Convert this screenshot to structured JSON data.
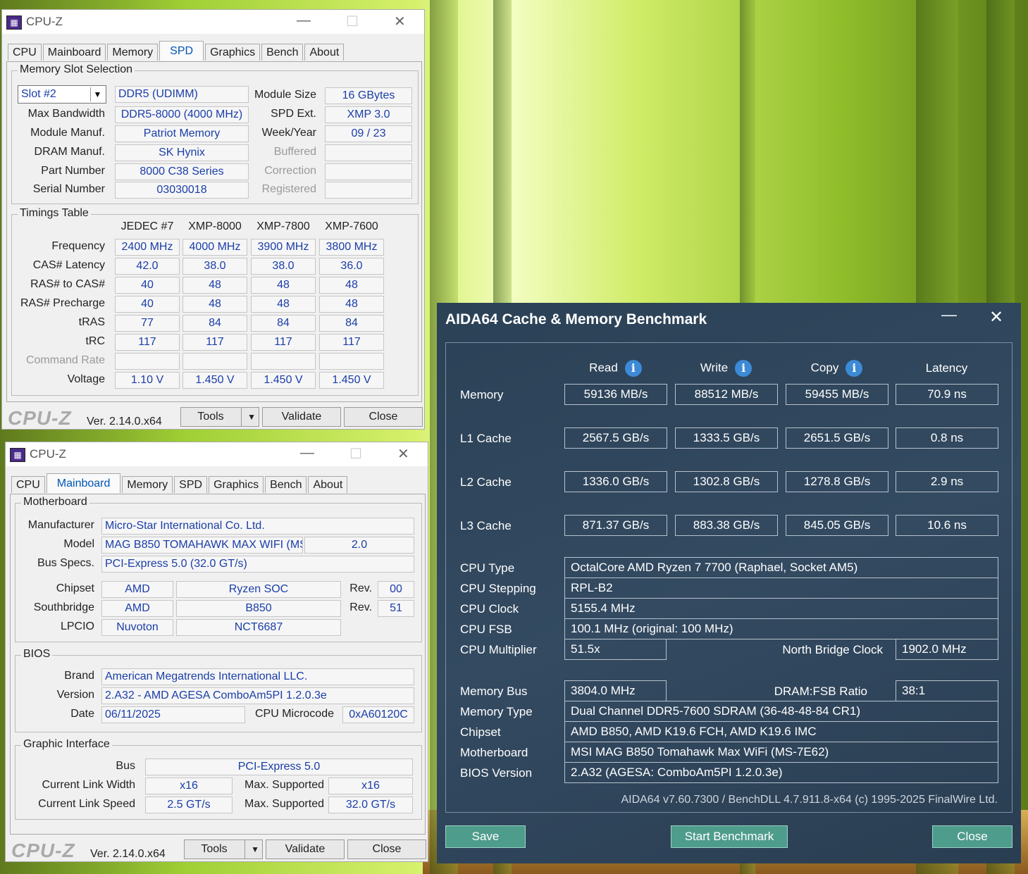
{
  "cpuz1": {
    "title": "CPU-Z",
    "tabs": [
      "CPU",
      "Mainboard",
      "Memory",
      "SPD",
      "Graphics",
      "Bench",
      "About"
    ],
    "slot_group": "Memory Slot Selection",
    "slot": "Slot #2",
    "type": "DDR5 (UDIMM)",
    "rows": [
      {
        "label": "Max Bandwidth",
        "value": "DDR5-8000 (4000 MHz)"
      },
      {
        "label": "Module Manuf.",
        "value": "Patriot Memory"
      },
      {
        "label": "DRAM Manuf.",
        "value": "SK Hynix"
      },
      {
        "label": "Part Number",
        "value": "8000 C38 Series"
      },
      {
        "label": "Serial Number",
        "value": "03030018"
      }
    ],
    "right_rows": [
      {
        "label": "Module Size",
        "value": "16 GBytes"
      },
      {
        "label": "SPD Ext.",
        "value": "XMP 3.0"
      },
      {
        "label": "Week/Year",
        "value": "09 / 23"
      },
      {
        "label": "Buffered",
        "value": ""
      },
      {
        "label": "Correction",
        "value": ""
      },
      {
        "label": "Registered",
        "value": ""
      }
    ],
    "timings_group": "Timings Table",
    "timing_cols": [
      "JEDEC #7",
      "XMP-8000",
      "XMP-7800",
      "XMP-7600"
    ],
    "timings": [
      {
        "label": "Frequency",
        "values": [
          "2400 MHz",
          "4000 MHz",
          "3900 MHz",
          "3800 MHz"
        ]
      },
      {
        "label": "CAS# Latency",
        "values": [
          "42.0",
          "38.0",
          "38.0",
          "36.0"
        ]
      },
      {
        "label": "RAS# to CAS#",
        "values": [
          "40",
          "48",
          "48",
          "48"
        ]
      },
      {
        "label": "RAS# Precharge",
        "values": [
          "40",
          "48",
          "48",
          "48"
        ]
      },
      {
        "label": "tRAS",
        "values": [
          "77",
          "84",
          "84",
          "84"
        ]
      },
      {
        "label": "tRC",
        "values": [
          "117",
          "117",
          "117",
          "117"
        ]
      },
      {
        "label": "Command Rate",
        "values": [
          "",
          "",
          "",
          ""
        ]
      },
      {
        "label": "Voltage",
        "values": [
          "1.10 V",
          "1.450 V",
          "1.450 V",
          "1.450 V"
        ]
      }
    ],
    "brand": "CPU-Z",
    "version": "Ver. 2.14.0.x64",
    "tools": "Tools",
    "validate": "Validate",
    "close": "Close"
  },
  "cpuz2": {
    "title": "CPU-Z",
    "tabs": [
      "CPU",
      "Mainboard",
      "Memory",
      "SPD",
      "Graphics",
      "Bench",
      "About"
    ],
    "mb_group": "Motherboard",
    "manufacturer_label": "Manufacturer",
    "manufacturer": "Micro-Star International Co. Ltd.",
    "model_label": "Model",
    "model": "MAG B850 TOMAHAWK MAX WIFI (MS",
    "model_rev": "2.0",
    "bus_label": "Bus Specs.",
    "bus": "PCI-Express 5.0 (32.0 GT/s)",
    "chipset_label": "Chipset",
    "chipset_vendor": "AMD",
    "chipset_name": "Ryzen SOC",
    "rev_label": "Rev.",
    "chipset_rev": "00",
    "south_label": "Southbridge",
    "south_vendor": "AMD",
    "south_name": "B850",
    "south_rev": "51",
    "lpcio_label": "LPCIO",
    "lpcio_vendor": "Nuvoton",
    "lpcio_name": "NCT6687",
    "bios_group": "BIOS",
    "brand_label": "Brand",
    "bios_brand": "American Megatrends International LLC.",
    "version_label": "Version",
    "bios_version": "2.A32 - AMD AGESA ComboAm5PI 1.2.0.3e",
    "date_label": "Date",
    "bios_date": "06/11/2025",
    "microcode_label": "CPU Microcode",
    "microcode": "0xA60120C",
    "gi_group": "Graphic Interface",
    "bus_gi_label": "Bus",
    "bus_gi": "PCI-Express 5.0",
    "link_width_label": "Current Link Width",
    "link_width": "x16",
    "max_sup_label": "Max. Supported",
    "max_width": "x16",
    "link_speed_label": "Current Link Speed",
    "link_speed": "2.5 GT/s",
    "max_speed": "32.0 GT/s",
    "brand": "CPU-Z",
    "version": "Ver. 2.14.0.x64",
    "tools": "Tools",
    "validate": "Validate",
    "close": "Close"
  },
  "aida": {
    "title": "AIDA64 Cache & Memory Benchmark",
    "cols": [
      "Read",
      "Write",
      "Copy",
      "Latency"
    ],
    "bench": [
      {
        "label": "Memory",
        "values": [
          "59136 MB/s",
          "88512 MB/s",
          "59455 MB/s",
          "70.9 ns"
        ]
      },
      {
        "label": "L1 Cache",
        "values": [
          "2567.5 GB/s",
          "1333.5 GB/s",
          "2651.5 GB/s",
          "0.8 ns"
        ]
      },
      {
        "label": "L2 Cache",
        "values": [
          "1336.0 GB/s",
          "1302.8 GB/s",
          "1278.8 GB/s",
          "2.9 ns"
        ]
      },
      {
        "label": "L3 Cache",
        "values": [
          "871.37 GB/s",
          "883.38 GB/s",
          "845.05 GB/s",
          "10.6 ns"
        ]
      }
    ],
    "cpu_type_label": "CPU Type",
    "cpu_type": "OctalCore AMD Ryzen 7 7700  (Raphael, Socket AM5)",
    "cpu_stepping_label": "CPU Stepping",
    "cpu_stepping": "RPL-B2",
    "cpu_clock_label": "CPU Clock",
    "cpu_clock": "5155.4 MHz",
    "cpu_fsb_label": "CPU FSB",
    "cpu_fsb": "100.1 MHz  (original: 100 MHz)",
    "cpu_mult_label": "CPU Multiplier",
    "cpu_mult": "51.5x",
    "nb_clock_label": "North Bridge Clock",
    "nb_clock": "1902.0 MHz",
    "mem_bus_label": "Memory Bus",
    "mem_bus": "3804.0 MHz",
    "dram_ratio_label": "DRAM:FSB Ratio",
    "dram_ratio": "38:1",
    "mem_type_label": "Memory Type",
    "mem_type": "Dual Channel DDR5-7600 SDRAM  (36-48-48-84 CR1)",
    "chipset_label": "Chipset",
    "chipset": "AMD B850, AMD K19.6 FCH, AMD K19.6 IMC",
    "mobo_label": "Motherboard",
    "mobo": "MSI MAG B850 Tomahawk Max WiFi (MS-7E62)",
    "bios_label": "BIOS Version",
    "bios": "2.A32  (AGESA: ComboAm5PI 1.2.0.3e)",
    "footer": "AIDA64 v7.60.7300 / BenchDLL 4.7.911.8-x64  (c) 1995-2025 FinalWire Ltd.",
    "save": "Save",
    "start": "Start Benchmark",
    "close": "Close"
  }
}
